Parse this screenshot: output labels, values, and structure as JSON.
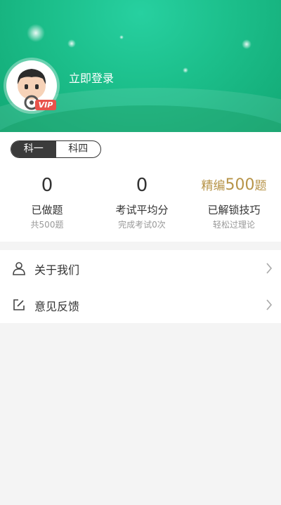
{
  "header": {
    "login_text": "立即登录",
    "vip_badge": "VIP",
    "colors": {
      "gradient_start": "#27d0a0",
      "gradient_end": "#12a874"
    }
  },
  "subject_tabs": [
    {
      "label": "科一",
      "active": true
    },
    {
      "label": "科四",
      "active": false
    }
  ],
  "stats": [
    {
      "value": "0",
      "label": "已做题",
      "sub": "共500题"
    },
    {
      "value": "0",
      "label": "考试平均分",
      "sub": "完成考试0次"
    },
    {
      "prefix": "精编",
      "number": "500",
      "suffix": "题",
      "label": "已解锁技巧",
      "sub": "轻松过理论"
    }
  ],
  "menu": [
    {
      "label": "关于我们",
      "icon": "person-icon"
    },
    {
      "label": "意见反馈",
      "icon": "edit-icon"
    }
  ],
  "accent_gold": "#b79449"
}
